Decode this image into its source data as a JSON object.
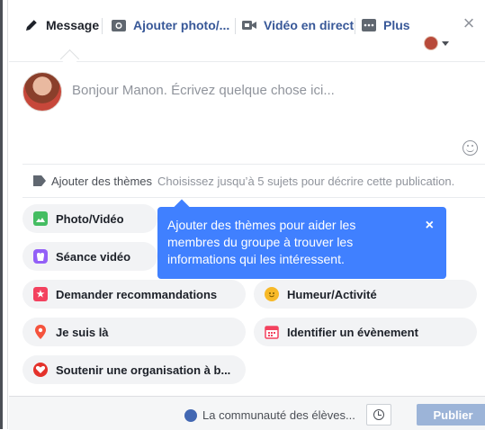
{
  "tabs": {
    "message": "Message",
    "photo": "Ajouter photo/...",
    "live": "Vidéo en direct",
    "more": "Plus"
  },
  "composer": {
    "placeholder": "Bonjour Manon. Écrivez quelque chose ici..."
  },
  "topics": {
    "label": "Ajouter des thèmes",
    "placeholder": "Choisissez jusqu’à 5 sujets pour décrire cette publication."
  },
  "options": {
    "photo_video": "Photo/Vidéo",
    "watch_party": "Séance vidéo",
    "recommendations": "Demander recommandations",
    "feeling": "Humeur/Activité",
    "checkin": "Je suis là",
    "event": "Identifier un évènement",
    "fundraiser": "Soutenir une organisation à b..."
  },
  "tooltip": {
    "text": "Ajouter des thèmes pour aider les membres du groupe à trouver les informations qui les intéressent.",
    "close": "×"
  },
  "footer": {
    "audience": "La communauté des élèves...",
    "publish": "Publier"
  },
  "icons": {
    "message": "pencil-icon",
    "photo": "camera-icon",
    "live": "video-camera-icon",
    "more": "more-icon",
    "close": "close-icon"
  },
  "colors": {
    "accent": "#4080ff",
    "link": "#385898",
    "publish_disabled": "#9cb4d8"
  }
}
